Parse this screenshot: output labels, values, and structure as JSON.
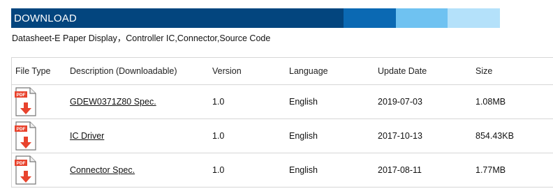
{
  "header": {
    "title": "DOWNLOAD",
    "bar_colors": [
      "#03457e",
      "#0b69b3",
      "#6fc2f1",
      "#b4e1fa"
    ]
  },
  "subtitle": "Datasheet-E Paper Display，Controller IC,Connector,Source Code",
  "table": {
    "columns": [
      "File Type",
      "Description (Downloadable)",
      "Version",
      "Language",
      "Update Date",
      "Size"
    ],
    "rows": [
      {
        "icon": "pdf-icon",
        "icon_label": "PDF",
        "description": "GDEW0371Z80 Spec.",
        "version": "1.0",
        "language": "English",
        "date": "2019-07-03",
        "size": "1.08MB"
      },
      {
        "icon": "pdf-icon",
        "icon_label": "PDF",
        "description": "IC Driver",
        "version": "1.0",
        "language": "English",
        "date": "2017-10-13",
        "size": "854.43KB"
      },
      {
        "icon": "pdf-icon",
        "icon_label": "PDF",
        "description": "Connector Spec.",
        "version": "1.0",
        "language": "English",
        "date": "2017-08-11",
        "size": "1.77MB"
      }
    ]
  },
  "colors": {
    "pdf_red": "#e8432d",
    "border": "#d6d6d6"
  }
}
